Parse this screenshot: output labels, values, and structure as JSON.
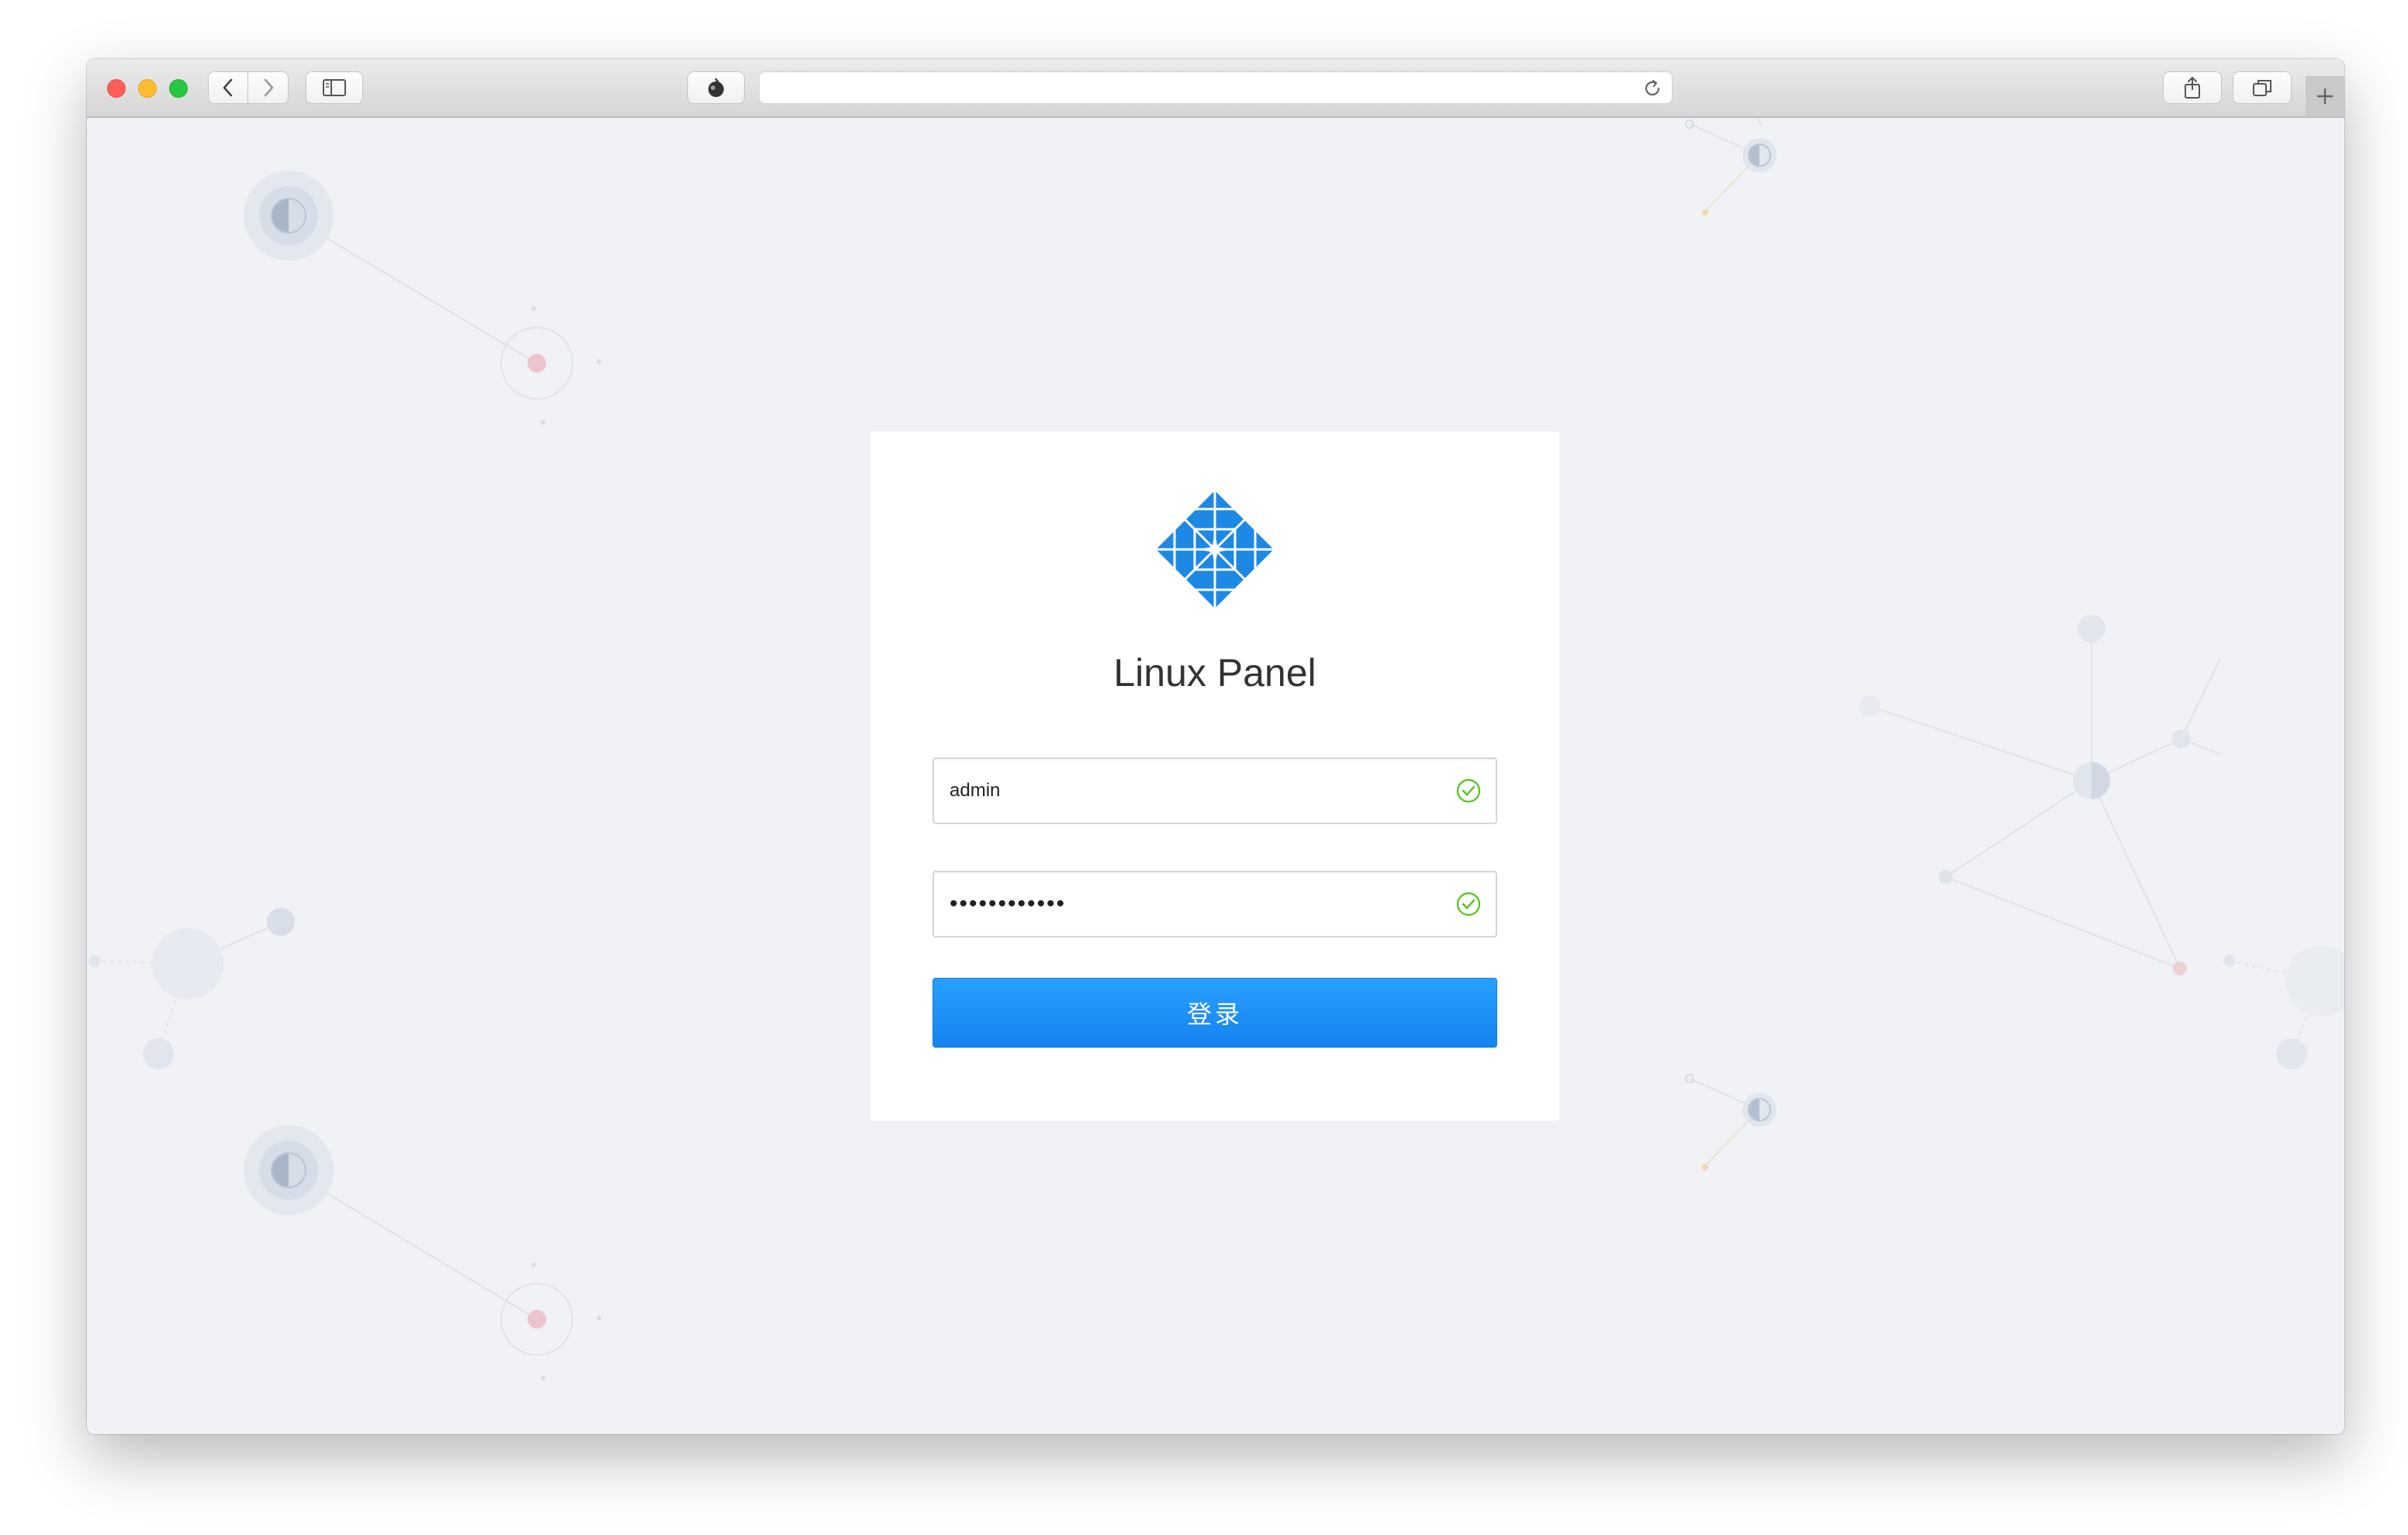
{
  "browser": {
    "address": "",
    "icons": {
      "back": "chevron-left-icon",
      "forward": "chevron-right-icon",
      "sidebar": "sidebar-icon",
      "privacy": "shield-icon",
      "reload": "reload-icon",
      "share": "share-icon",
      "tabs": "tabs-icon",
      "new_tab": "plus-icon"
    }
  },
  "login": {
    "title": "Linux Panel",
    "username": {
      "value": "admin",
      "valid": true
    },
    "password": {
      "value": "adminadmin12",
      "valid": true
    },
    "submit_label": "登录",
    "logo": "centos-logo"
  },
  "colors": {
    "accent": "#1890ff",
    "valid": "#52c41a",
    "background": "#f0f2f5"
  }
}
